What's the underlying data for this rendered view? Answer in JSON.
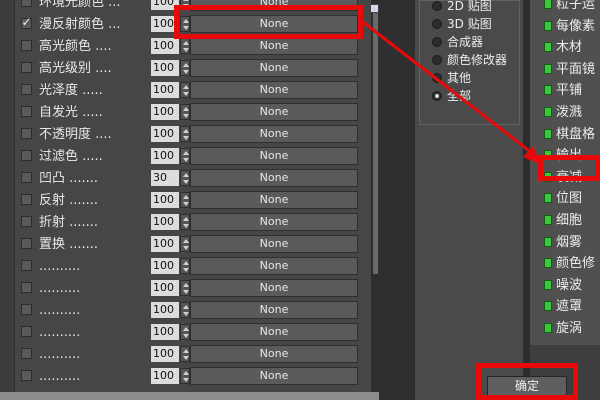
{
  "rows": [
    {
      "label": "环境光颜色 ...",
      "amount": "100",
      "map": "None",
      "checked": false
    },
    {
      "label": "漫反射颜色 ...",
      "amount": "100",
      "map": "None",
      "checked": true
    },
    {
      "label": "高光颜色 ....",
      "amount": "100",
      "map": "None",
      "checked": false
    },
    {
      "label": "高光级别 ....",
      "amount": "100",
      "map": "None",
      "checked": false
    },
    {
      "label": "光泽度 .....",
      "amount": "100",
      "map": "None",
      "checked": false
    },
    {
      "label": "自发光 .....",
      "amount": "100",
      "map": "None",
      "checked": false
    },
    {
      "label": "不透明度 ....",
      "amount": "100",
      "map": "None",
      "checked": false
    },
    {
      "label": "过滤色 .....",
      "amount": "100",
      "map": "None",
      "checked": false
    },
    {
      "label": "凹凸 .......",
      "amount": "30",
      "map": "None",
      "checked": false
    },
    {
      "label": "反射 .......",
      "amount": "100",
      "map": "None",
      "checked": false
    },
    {
      "label": "折射 .......",
      "amount": "100",
      "map": "None",
      "checked": false
    },
    {
      "label": "置换 .......",
      "amount": "100",
      "map": "None",
      "checked": false
    },
    {
      "label": "..........",
      "amount": "100",
      "map": "None",
      "checked": false
    },
    {
      "label": "..........",
      "amount": "100",
      "map": "None",
      "checked": false
    },
    {
      "label": "..........",
      "amount": "100",
      "map": "None",
      "checked": false
    },
    {
      "label": "..........",
      "amount": "100",
      "map": "None",
      "checked": false
    },
    {
      "label": "..........",
      "amount": "100",
      "map": "None",
      "checked": false
    },
    {
      "label": "..........",
      "amount": "100",
      "map": "None",
      "checked": false
    }
  ],
  "map_types": [
    {
      "label": "2D 贴图",
      "selected": false
    },
    {
      "label": "3D 贴图",
      "selected": false
    },
    {
      "label": "合成器",
      "selected": false
    },
    {
      "label": "颜色修改器",
      "selected": false
    },
    {
      "label": "其他",
      "selected": false
    },
    {
      "label": "全部",
      "selected": true
    }
  ],
  "map_list": [
    "粒子运",
    "每像素",
    "木材",
    "平面镜",
    "平铺",
    "泼溅",
    "棋盘格",
    "输出",
    "衰减",
    "位图",
    "细胞",
    "烟雾",
    "颜色修",
    "噪波",
    "遮罩",
    "旋涡"
  ],
  "ok_label": "确定",
  "colors": {
    "annotation_red": "#e80a0a",
    "icon_green": "#3cc83c",
    "panel_gray": "#464646"
  }
}
